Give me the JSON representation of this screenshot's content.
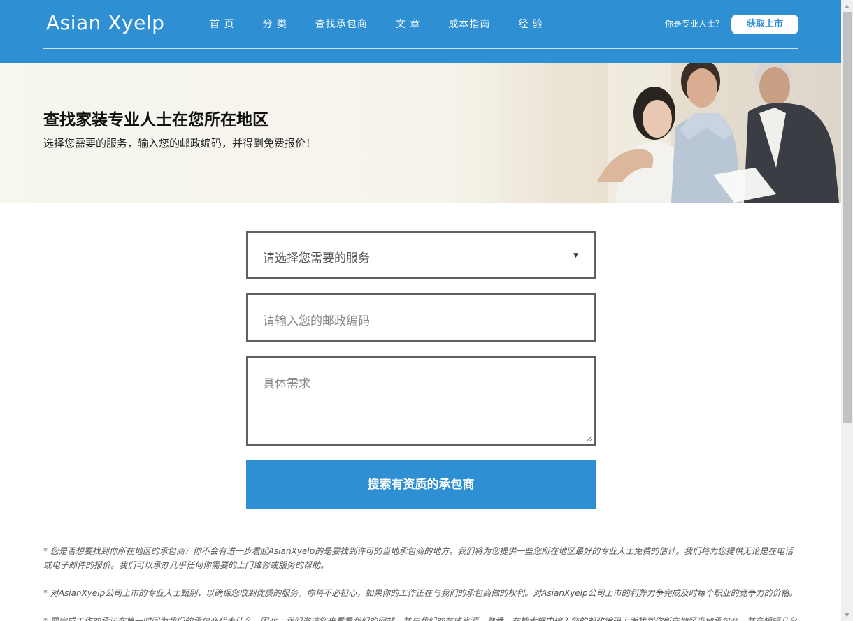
{
  "brand": {
    "name": "Asian Xyelp"
  },
  "nav": {
    "items": [
      {
        "label": "首 页"
      },
      {
        "label": "分 类"
      },
      {
        "label": "查找承包商"
      },
      {
        "label": "文 章"
      },
      {
        "label": "成本指南"
      },
      {
        "label": "经 验"
      }
    ],
    "pro_question": "你是专业人士？",
    "cta_label": "获取上市"
  },
  "hero": {
    "title": "查找家装专业人士在您所在地区",
    "subtitle": "选择您需要的服务，输入您的邮政编码，并得到免费报价！"
  },
  "form": {
    "service_placeholder": "请选择您需要的服务",
    "zip_placeholder": "请输入您的邮政编码",
    "details_placeholder": "具体需求",
    "submit_label": "搜索有资质的承包商"
  },
  "notes": [
    "* 您是否想要找到你所在地区的承包商？你不会有进一步看起AsianXyelp的是要找到许可的当地承包商的地方。我们将为您提供一些您所在地区最好的专业人士免费的估计。我们将为您提供无论是在电话或电子邮件的报价。我们可以承办几乎任何你需要的上门维修或服务的帮助。",
    "* 对AsianXyelp公司上市的专业人士甄别，以确保您收到优质的服务。你将不必担心，如果你的工作正在与我们的承包商做的权利。对AsianXyelp公司上市的利弊力争完成及时每个职业的竞争力的价格。",
    "* 要完成工作的承诺在第一时间为我们的承包商代表什么。因此，我们邀请您来看看我们的网站，并与我们的在线资源。熟悉，在搜索框中输入您的邮政编码上面找到你所在地区当地承包商，并在短短几分"
  ],
  "colors": {
    "brand_blue": "#2f8fd3",
    "field_border": "#606060"
  }
}
